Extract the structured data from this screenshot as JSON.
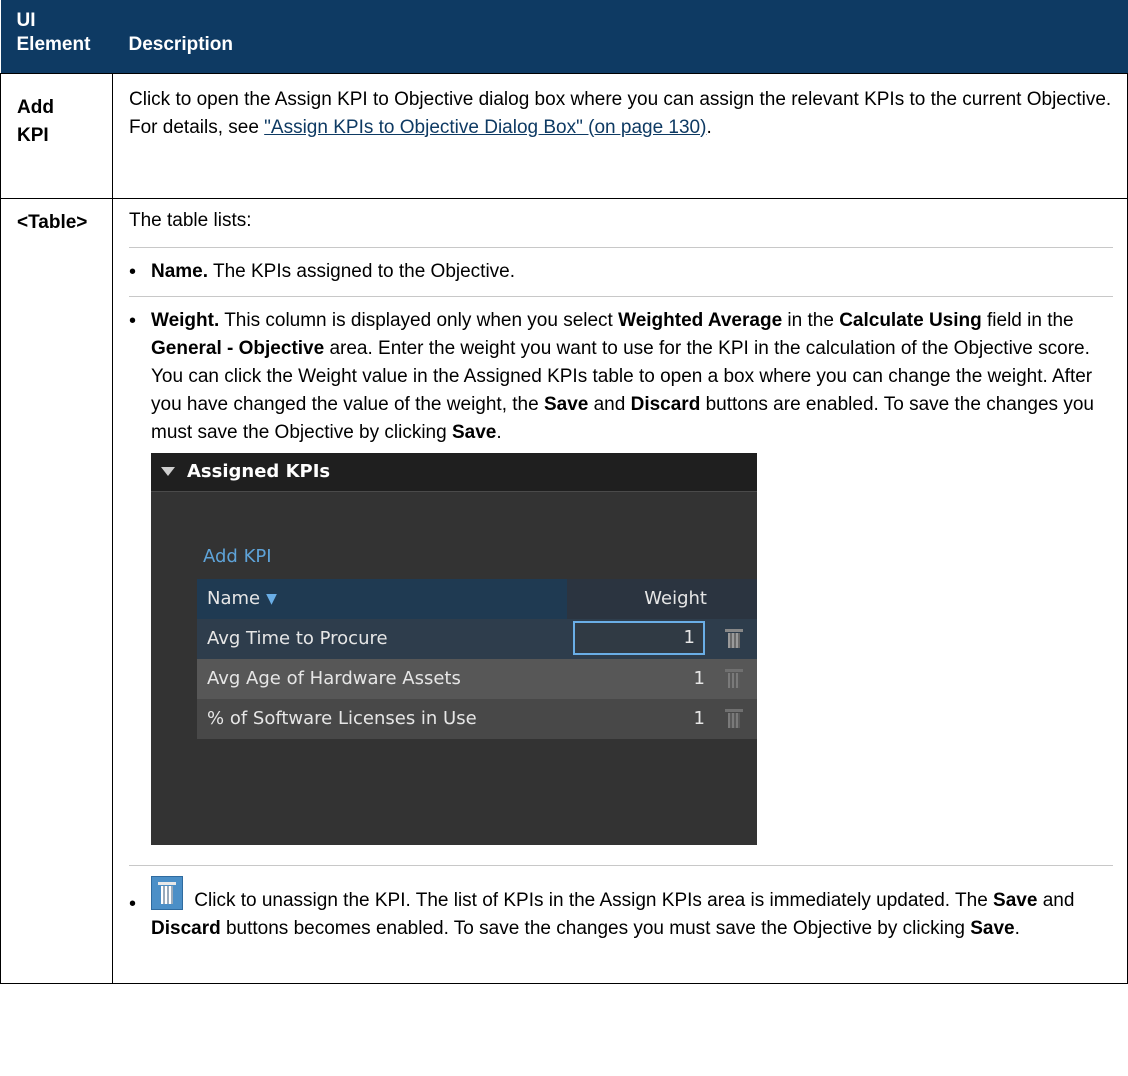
{
  "header": {
    "col1_line1": "UI",
    "col1_line2": "Element",
    "col2": "Description"
  },
  "rows": {
    "add_kpi": {
      "element_line1": "Add",
      "element_line2": "KPI",
      "text_before": "Click to open the Assign KPI to Objective dialog box where you can assign the relevant KPIs to the current Objective. For details, see ",
      "link": "\"Assign KPIs to Objective Dialog Box\" (on page 130)",
      "text_after": "."
    },
    "table": {
      "element": "<Table>",
      "intro": "The table lists:",
      "name_bold": "Name.",
      "name_text": " The KPIs assigned to the Objective.",
      "weight": {
        "b1": "Weight.",
        "t1": " This column is displayed only when you select ",
        "b2": "Weighted Average",
        "t2": " in the ",
        "b3": "Calculate Using",
        "t3": " field in the ",
        "b4": "General - Objective",
        "t4": " area. Enter the weight you want to use for the KPI in the calculation of the Objective score. You can click the Weight value in the Assigned KPIs table to open a box where you can change the weight. After you have changed the value of the weight, the ",
        "b5": "Save",
        "t5": " and ",
        "b6": "Discard",
        "t6": " buttons are enabled. To save the changes you must save the Objective by clicking ",
        "b7": "Save",
        "t7": "."
      },
      "trash": {
        "t1": " Click to unassign the KPI. The list of KPIs in the Assign KPIs area is immediately updated. The ",
        "b1": "Save",
        "t2": " and ",
        "b2": "Discard",
        "t3": " buttons becomes enabled. To save the changes you must save the Objective by clicking ",
        "b3": "Save",
        "t4": "."
      }
    }
  },
  "screenshot": {
    "title": "Assigned KPIs",
    "add_link": "Add KPI",
    "col_name": "Name",
    "col_weight": "Weight",
    "kpis": [
      {
        "name": "Avg Time to Procure",
        "weight": "1"
      },
      {
        "name": "Avg Age of Hardware Assets",
        "weight": "1"
      },
      {
        "name": "% of Software Licenses in Use",
        "weight": "1"
      }
    ]
  },
  "colors": {
    "header_bg": "#0e3a63",
    "link": "#0e3a63",
    "screenshot_accent": "#5ea3d8"
  }
}
